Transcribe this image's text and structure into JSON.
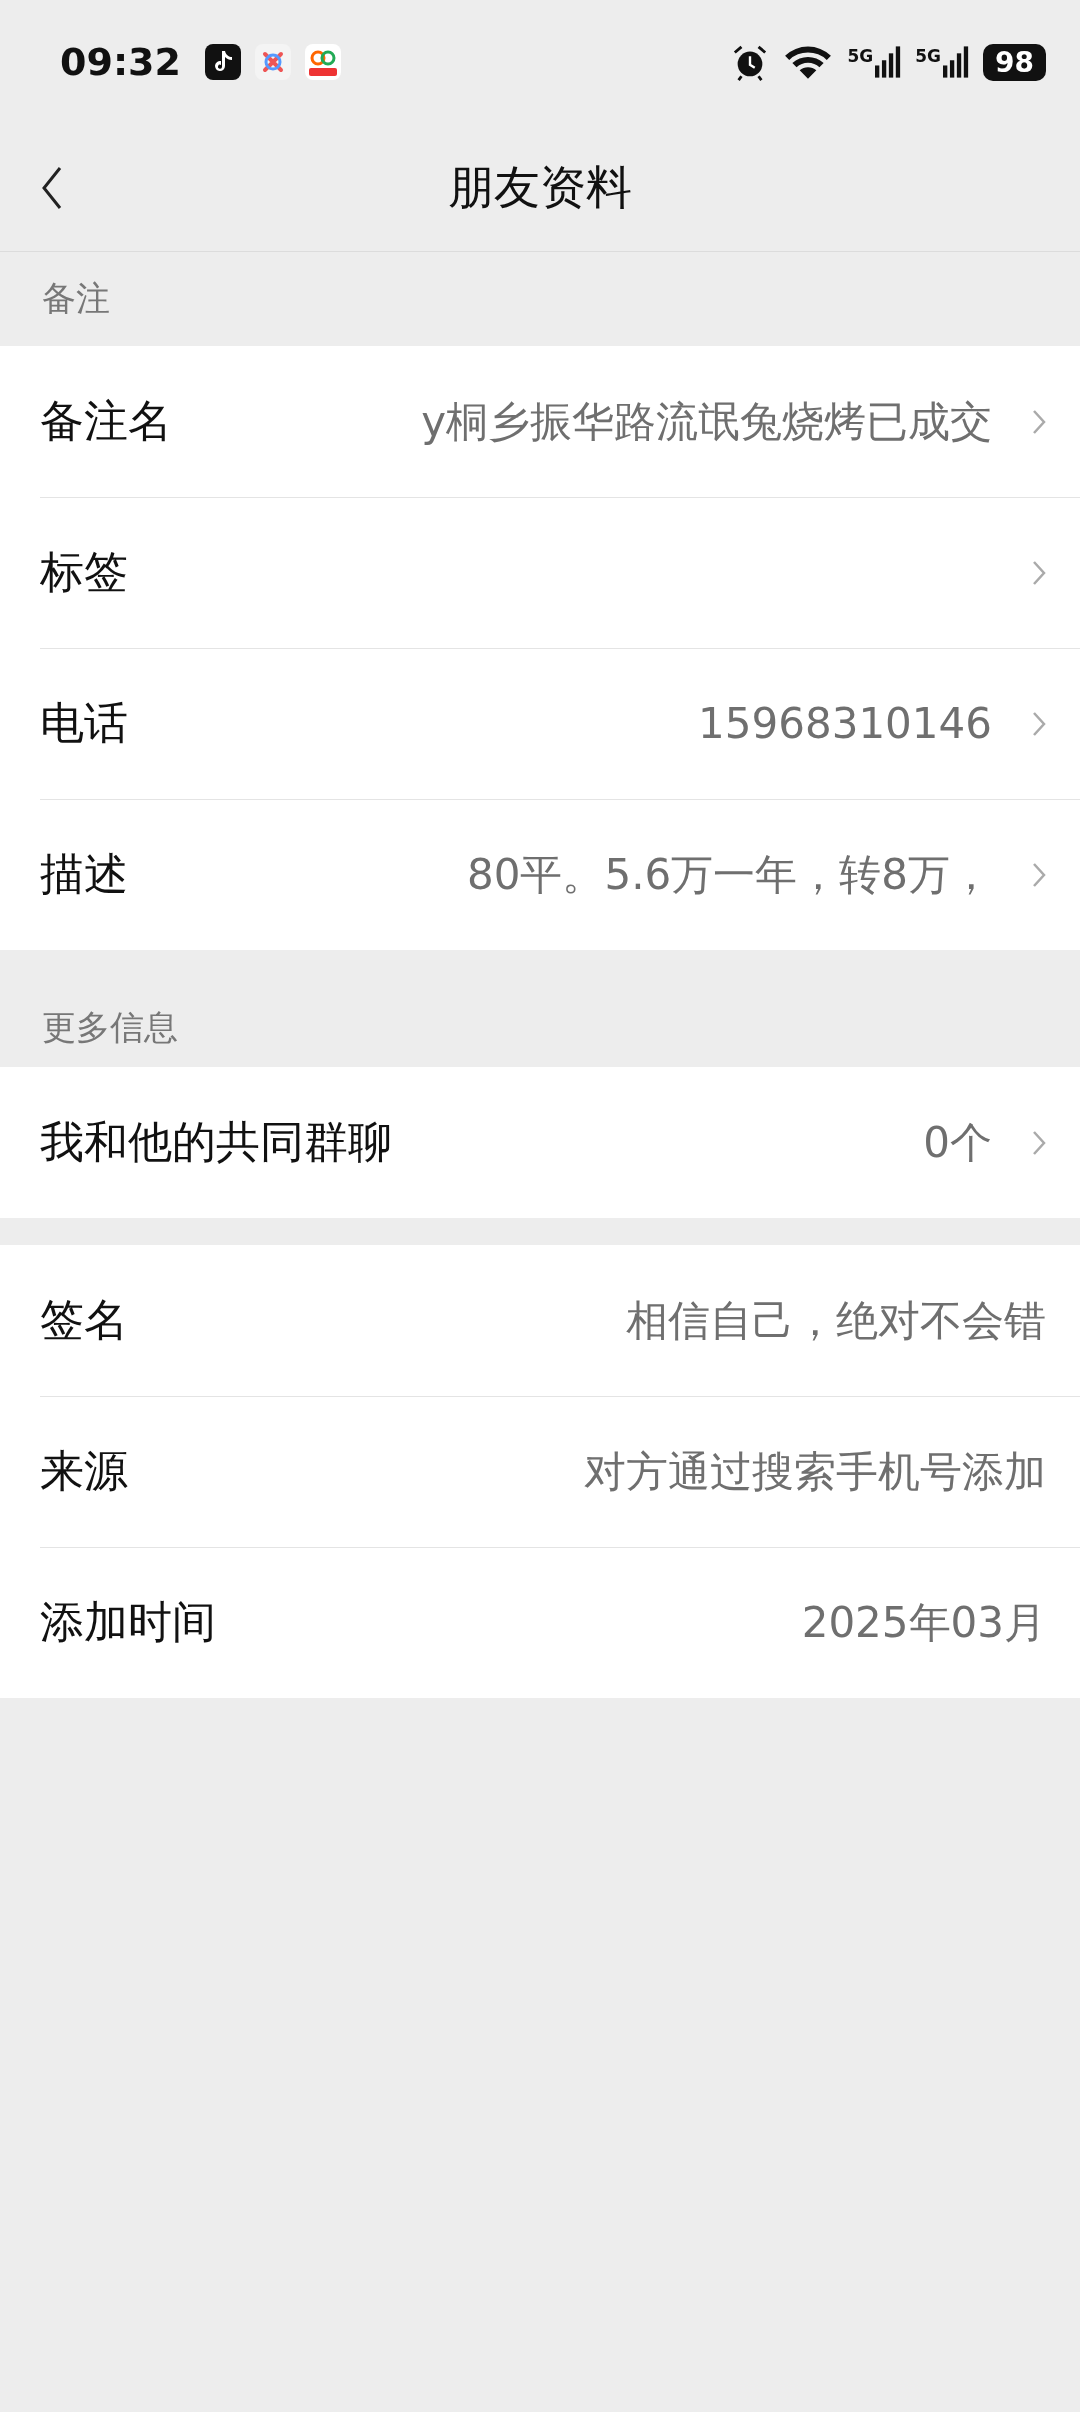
{
  "status_bar": {
    "time": "09:32",
    "network_labels": [
      "5G",
      "5G"
    ],
    "battery": "98"
  },
  "nav": {
    "title": "朋友资料"
  },
  "sections": [
    {
      "header": "备注",
      "rows": [
        {
          "label": "备注名",
          "value": "y桐乡振华路流氓兔烧烤已成交",
          "chevron": true
        },
        {
          "label": "标签",
          "chevron": true
        },
        {
          "label": "电话",
          "value": "15968310146",
          "chevron": true
        },
        {
          "label": "描述",
          "value": "80平。5.6万一年，转8万，",
          "chevron": true
        }
      ]
    },
    {
      "header": "更多信息",
      "rows": [
        {
          "label": "我和他的共同群聊",
          "value": "0个",
          "chevron": true
        }
      ]
    },
    {
      "rows": [
        {
          "label": "签名",
          "value": "相信自己，绝对不会错",
          "chevron": false
        },
        {
          "label": "来源",
          "value": "对方通过搜索手机号添加",
          "chevron": false
        },
        {
          "label": "添加时间",
          "value": "2025年03月",
          "chevron": false
        }
      ]
    }
  ]
}
